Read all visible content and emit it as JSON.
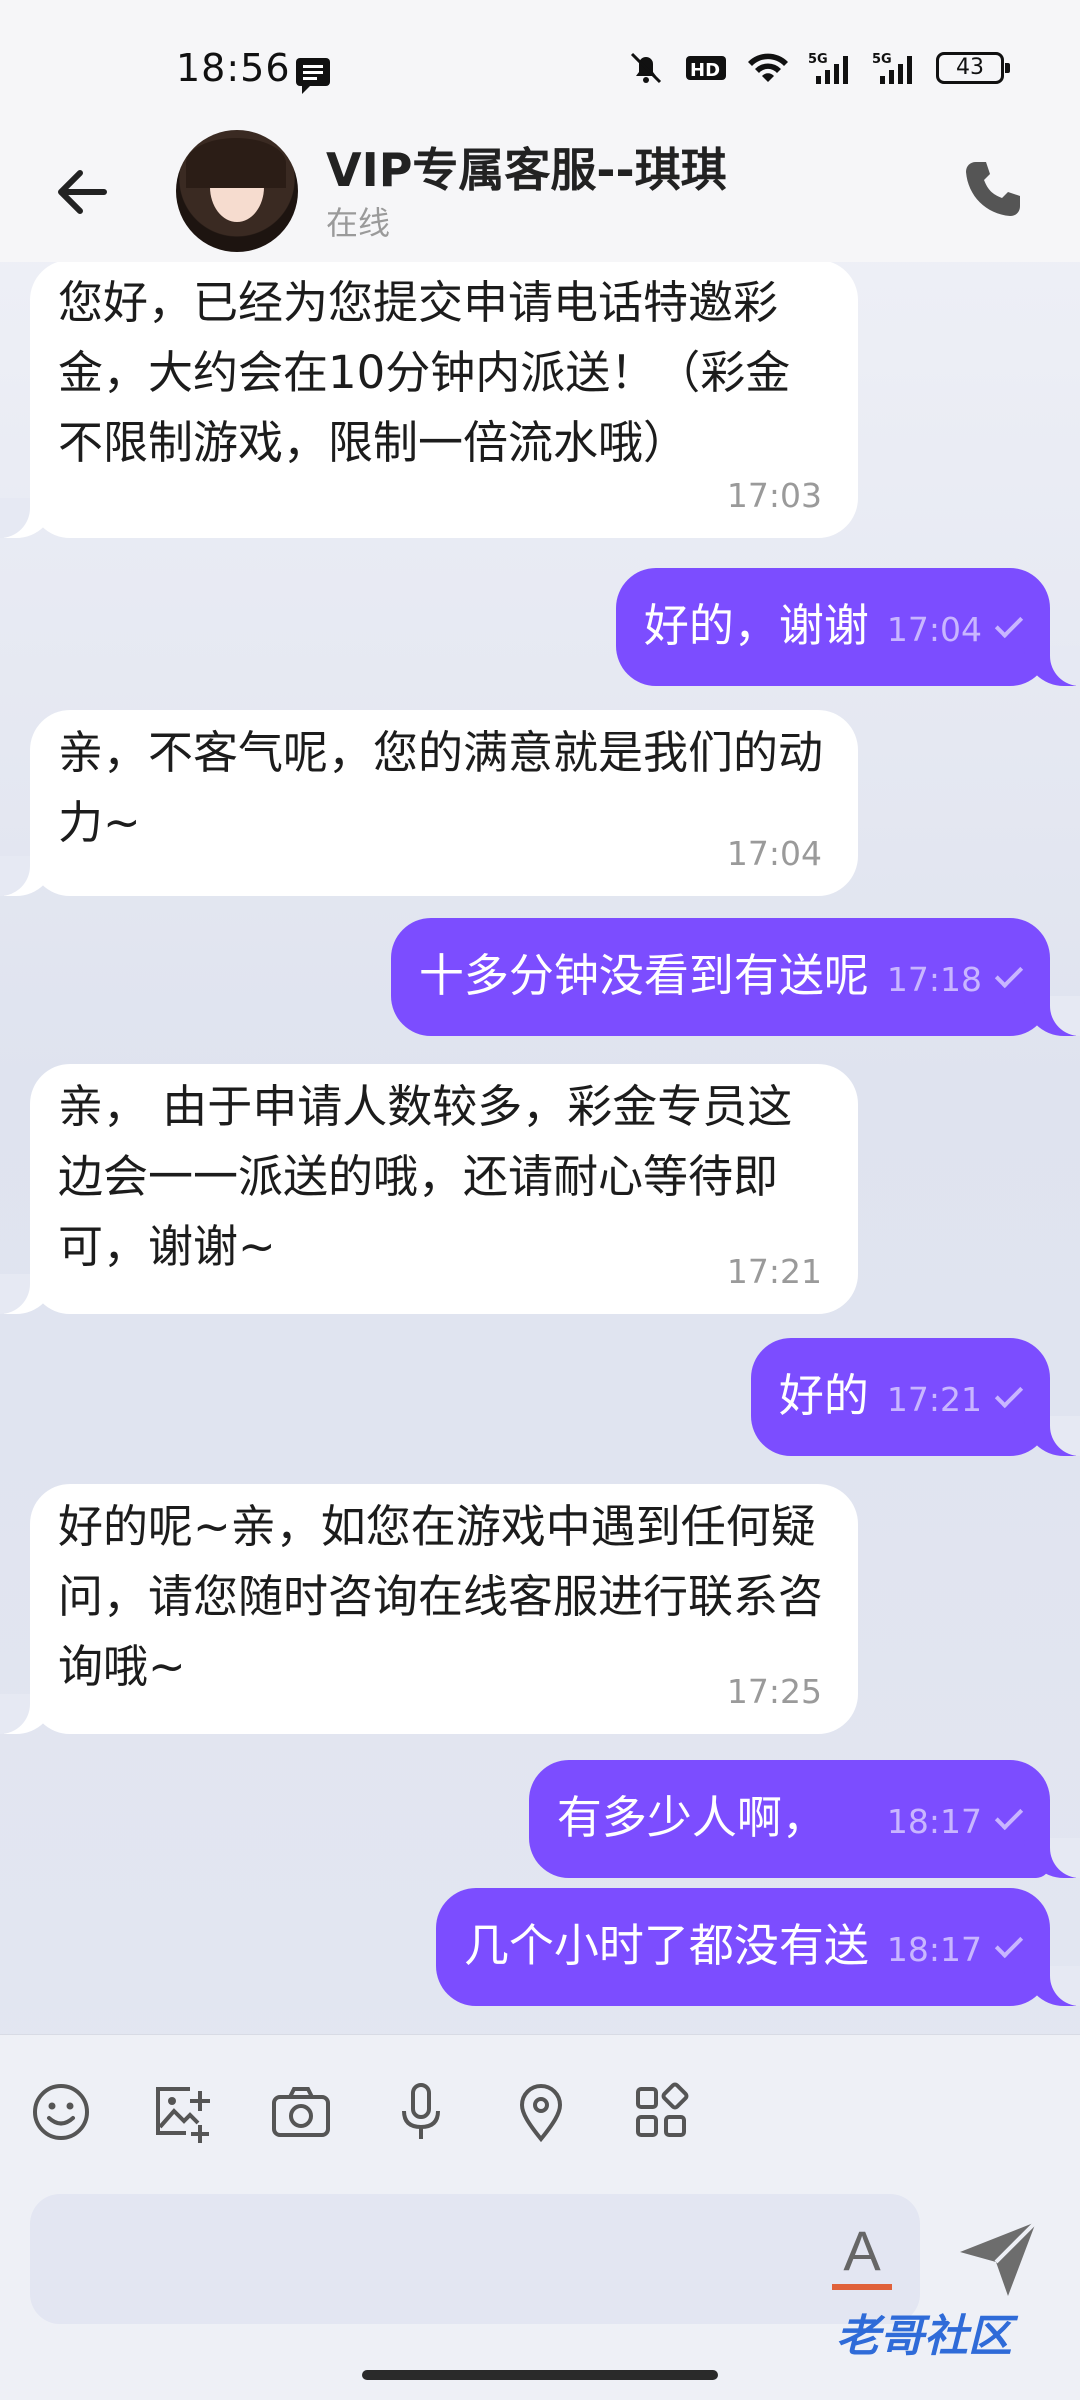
{
  "status_bar": {
    "time": "18:56",
    "battery": "43",
    "network_labels": [
      "5G",
      "5G"
    ],
    "hd_label": "HD"
  },
  "header": {
    "title": "VIP专属客服--琪琪",
    "status": "在线"
  },
  "messages": [
    {
      "dir": "in",
      "text": "您好，已经为您提交申请电话特邀彩金，大约会在10分钟内派送！（彩金不限制游戏，限制一倍流水哦）",
      "time": "17:03"
    },
    {
      "dir": "out",
      "text": "好的，谢谢",
      "time": "17:04"
    },
    {
      "dir": "in",
      "text": "亲，不客气呢，您的满意就是我们的动力~",
      "time": "17:04"
    },
    {
      "dir": "out",
      "text": "十多分钟没看到有送呢",
      "time": "17:18"
    },
    {
      "dir": "in",
      "text": "亲， 由于申请人数较多，彩金专员这边会一一派送的哦，还请耐心等待即可，谢谢~",
      "time": "17:21"
    },
    {
      "dir": "out",
      "text": "好的",
      "time": "17:21"
    },
    {
      "dir": "in",
      "text": "好的呢~亲，如您在游戏中遇到任何疑问，请您随时咨询在线客服进行联系咨询哦~",
      "time": "17:25"
    },
    {
      "dir": "out",
      "text": "有多少人啊，",
      "time": "18:17"
    },
    {
      "dir": "out",
      "text": "几个小时了都没有送",
      "time": "18:17"
    }
  ],
  "toolbar": {
    "icons": [
      "emoji-icon",
      "image-add-icon",
      "camera-icon",
      "microphone-icon",
      "location-icon",
      "apps-icon"
    ]
  },
  "composer": {
    "font_button_label": "A",
    "watermark": "老哥社区"
  },
  "colors": {
    "accent": "#7c4dff",
    "incoming_bubble": "#ffffff"
  }
}
